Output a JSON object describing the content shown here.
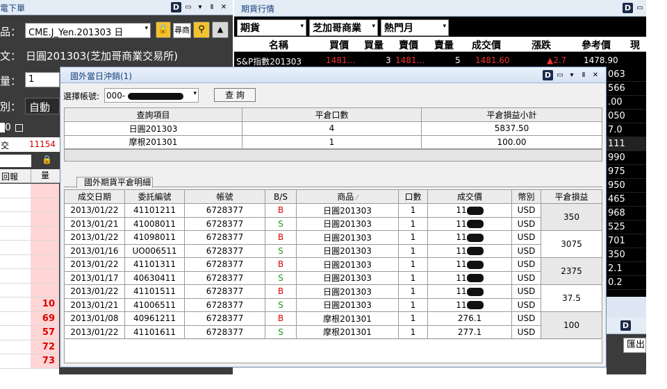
{
  "left_panel": {
    "title": "電下單",
    "product_label": "品：",
    "product_value": "CME.J_Yen.201303 日",
    "query_btn": "尋商",
    "desc_label": "文：",
    "desc_value": "日圓201303(芝加哥商業交易所)",
    "qty_label": "量：",
    "qty_value": "1",
    "type_label": "別：",
    "type_value": "自動",
    "flag_text": "0",
    "trade_label": "交",
    "trade_value": "11154",
    "col_report": "回報",
    "col_qty": "量",
    "qty_values": [
      "10",
      "69",
      "57",
      "72",
      "73"
    ]
  },
  "quote_panel": {
    "title": "期貨行情",
    "select1": "期貨",
    "select2": "芝加哥商業",
    "select3": "熱門月",
    "headers": [
      "名稱",
      "買價",
      "買量",
      "賣價",
      "賣量",
      "成交價",
      "漲跌",
      "參考價",
      "現"
    ],
    "row1": {
      "name": "S&P指數201303",
      "bid": "1481...",
      "bid_qty": "3",
      "ask": "1481...",
      "ask_qty": "5",
      "last": "1481.60",
      "change": "▲2.7",
      "ref": "1478.90"
    },
    "right_col": [
      "063",
      "566",
      ".00",
      "050",
      "7.0",
      "111",
      "990",
      "975",
      "950",
      "465",
      "968",
      "525",
      "701",
      "350",
      "2.1",
      "0.2"
    ],
    "dialog_btn": "匯出"
  },
  "dialog": {
    "title": "國外當日沖銷(1)",
    "account_label": "選擇帳號:",
    "account_value": "000-",
    "query_button": "查 詢",
    "summary_headers": [
      "查詢項目",
      "平倉口數",
      "平倉損益小計"
    ],
    "summary_rows": [
      {
        "item": "日圓201303",
        "qty": "4",
        "pnl": "5837.50"
      },
      {
        "item": "摩根201301",
        "qty": "1",
        "pnl": "100.00"
      }
    ],
    "tab_label": "國外期貨平倉明細",
    "detail_headers": [
      "成交日期",
      "委託編號",
      "帳號",
      "B/S",
      "商品",
      "口數",
      "成交價",
      "幣別",
      "平倉損益"
    ],
    "detail_rows": [
      {
        "date": "2013/01/22",
        "order": "41101211",
        "acct": "6728377",
        "bs": "B",
        "product": "日圓201303",
        "qty": "1",
        "price": "11",
        "ccy": "USD"
      },
      {
        "date": "2013/01/21",
        "order": "41008011",
        "acct": "6728377",
        "bs": "S",
        "product": "日圓201303",
        "qty": "1",
        "price": "11",
        "ccy": "USD"
      },
      {
        "date": "2013/01/22",
        "order": "41098011",
        "acct": "6728377",
        "bs": "B",
        "product": "日圓201303",
        "qty": "1",
        "price": "11",
        "ccy": "USD"
      },
      {
        "date": "2013/01/16",
        "order": "UO006511",
        "acct": "6728377",
        "bs": "S",
        "product": "日圓201303",
        "qty": "1",
        "price": "11",
        "ccy": "USD"
      },
      {
        "date": "2013/01/22",
        "order": "41101311",
        "acct": "6728377",
        "bs": "B",
        "product": "日圓201303",
        "qty": "1",
        "price": "11",
        "ccy": "USD"
      },
      {
        "date": "2013/01/17",
        "order": "40630411",
        "acct": "6728377",
        "bs": "S",
        "product": "日圓201303",
        "qty": "1",
        "price": "11",
        "ccy": "USD"
      },
      {
        "date": "2013/01/22",
        "order": "41101511",
        "acct": "6728377",
        "bs": "B",
        "product": "日圓201303",
        "qty": "1",
        "price": "11",
        "ccy": "USD"
      },
      {
        "date": "2013/01/21",
        "order": "41006511",
        "acct": "6728377",
        "bs": "S",
        "product": "日圓201303",
        "qty": "1",
        "price": "11",
        "ccy": "USD"
      },
      {
        "date": "2013/01/08",
        "order": "40961211",
        "acct": "6728377",
        "bs": "B",
        "product": "摩根201301",
        "qty": "1",
        "price": "276.1",
        "ccy": "USD"
      },
      {
        "date": "2013/01/22",
        "order": "41101611",
        "acct": "6728377",
        "bs": "S",
        "product": "摩根201301",
        "qty": "1",
        "price": "277.1",
        "ccy": "USD"
      }
    ],
    "pnl_values": [
      "350",
      "3075",
      "2375",
      "37.5",
      "100"
    ]
  }
}
